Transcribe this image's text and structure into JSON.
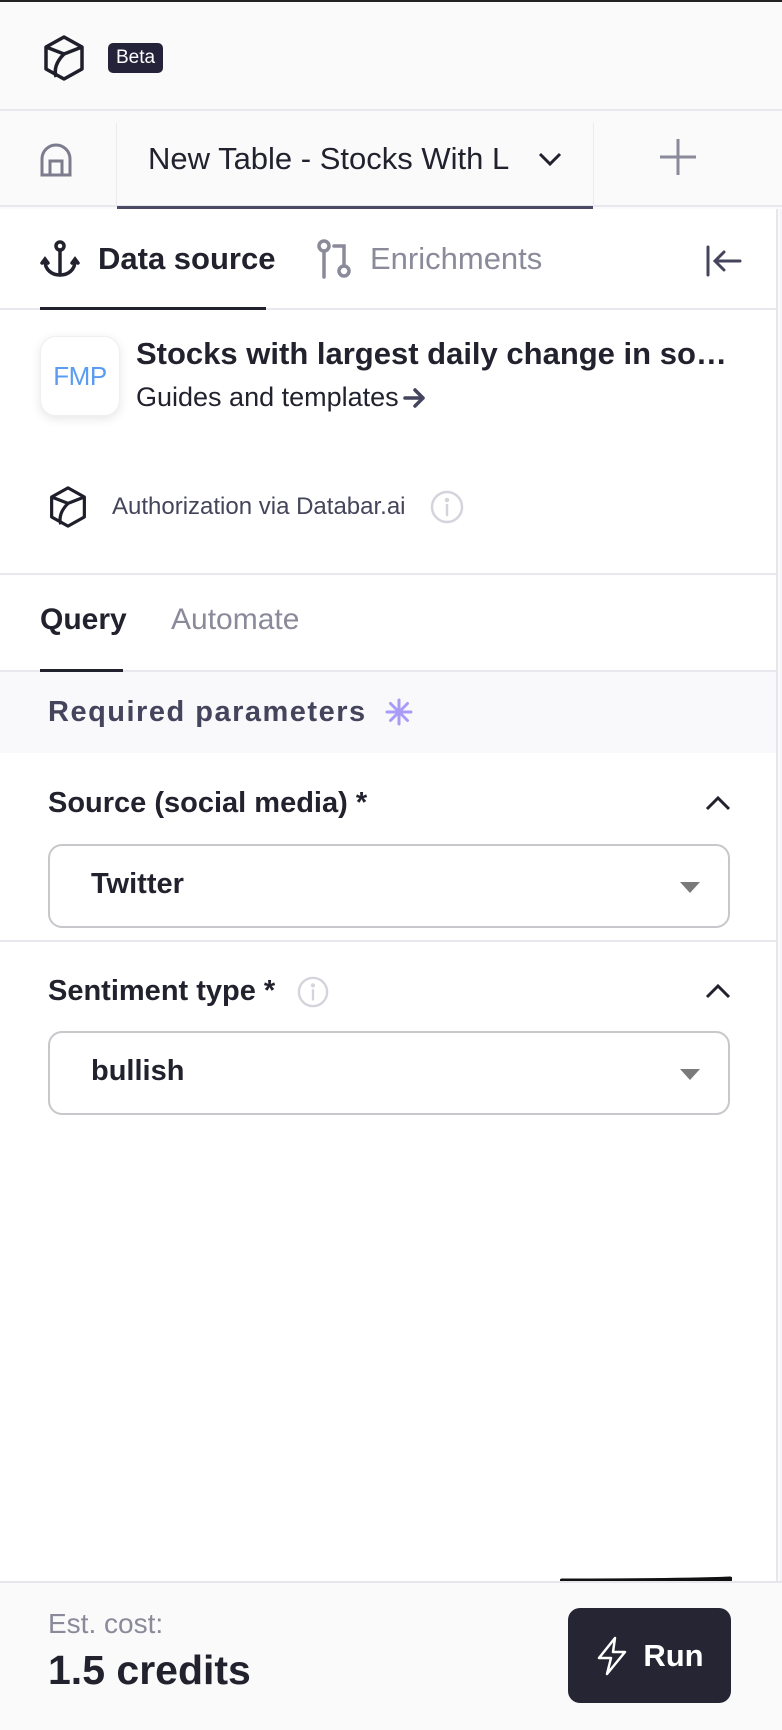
{
  "header": {
    "badge": "Beta"
  },
  "table_tabs": {
    "active_tab": "New Table - Stocks With L"
  },
  "source_tabs": [
    {
      "label": "Data source",
      "active": true
    },
    {
      "label": "Enrichments",
      "active": false
    }
  ],
  "source_card": {
    "logo_text": "FMP",
    "title": "Stocks with largest daily change in social sentiment",
    "guides_link": "Guides and templates",
    "auth_text": "Authorization via Databar.ai"
  },
  "query_tabs": [
    {
      "label": "Query",
      "active": true
    },
    {
      "label": "Automate",
      "active": false
    }
  ],
  "required_section": {
    "title": "Required parameters"
  },
  "fields": [
    {
      "label": "Source (social media) *",
      "value": "Twitter",
      "has_info": false
    },
    {
      "label": "Sentiment type *",
      "value": "bullish",
      "has_info": true
    }
  ],
  "footer": {
    "est_label": "Est. cost:",
    "credits": "1.5 credits",
    "run_label": "Run"
  },
  "colors": {
    "accent_dark": "#252533",
    "fmp_blue": "#5b9cf0",
    "required_star": "#a99cf7"
  }
}
